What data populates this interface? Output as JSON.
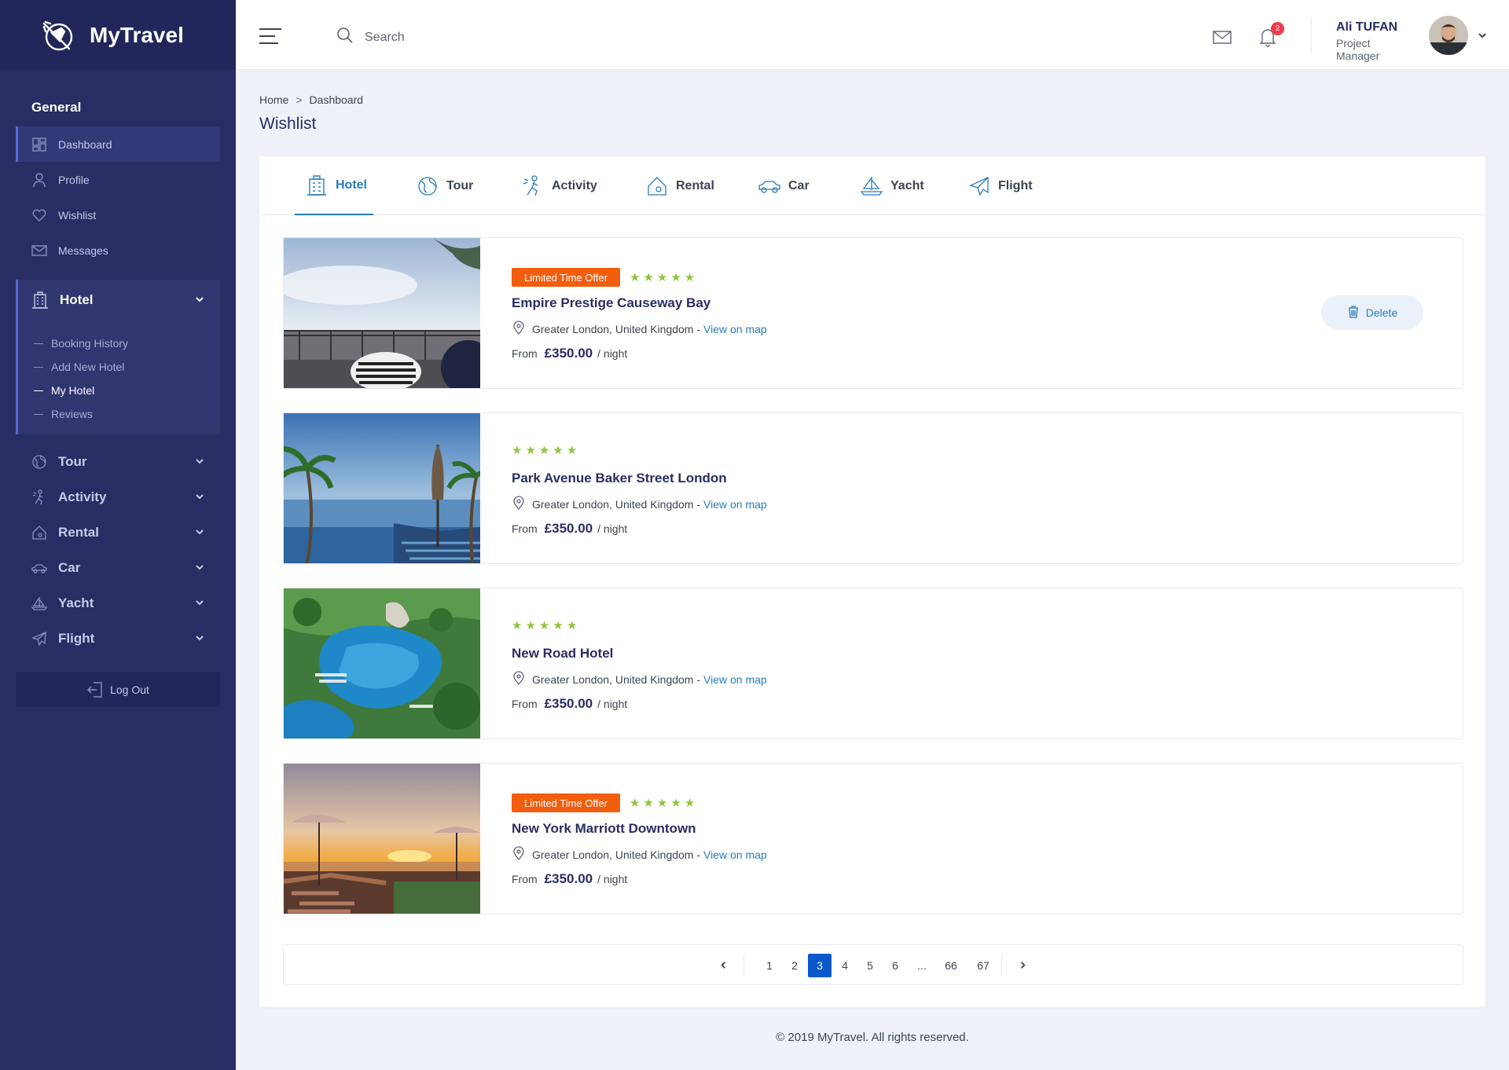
{
  "brand": {
    "name": "MyTravel"
  },
  "sidebar": {
    "section_title": "General",
    "items": [
      {
        "label": "Dashboard",
        "icon": "dashboard-icon"
      },
      {
        "label": "Profile",
        "icon": "user-icon"
      },
      {
        "label": "Wishlist",
        "icon": "heart-icon"
      },
      {
        "label": "Messages",
        "icon": "mail-icon"
      }
    ],
    "hotel_group": {
      "label": "Hotel",
      "subitems": [
        "Booking History",
        "Add New Hotel",
        "My Hotel",
        "Reviews"
      ]
    },
    "categories": [
      "Tour",
      "Activity",
      "Rental",
      "Car",
      "Yacht",
      "Flight"
    ],
    "logout_label": "Log Out"
  },
  "header": {
    "search_placeholder": "Search",
    "notification_count": "2",
    "user_name": "Ali TUFAN",
    "user_role": "Project Manager"
  },
  "breadcrumb": {
    "home": "Home",
    "sep": ">",
    "current": "Dashboard"
  },
  "page_title": "Wishlist",
  "tabs": [
    "Hotel",
    "Tour",
    "Activity",
    "Rental",
    "Car",
    "Yacht",
    "Flight"
  ],
  "active_tab": "Hotel",
  "hotels": [
    {
      "offer": "Limited Time Offer",
      "rating": 5,
      "name": "Empire Prestige Causeway Bay",
      "location": "Greater London, United Kingdom -",
      "map_link": "View on map",
      "from": "From",
      "price": "£350.00",
      "unit": "/ night",
      "delete_label": "Delete"
    },
    {
      "offer": "",
      "rating": 5,
      "name": "Park Avenue Baker Street London",
      "location": "Greater London, United Kingdom -",
      "map_link": "View on map",
      "from": "From",
      "price": "£350.00",
      "unit": "/ night"
    },
    {
      "offer": "",
      "rating": 5,
      "name": "New Road Hotel",
      "location": "Greater London, United Kingdom -",
      "map_link": "View on map",
      "from": "From",
      "price": "£350.00",
      "unit": "/ night"
    },
    {
      "offer": "Limited Time Offer",
      "rating": 5,
      "name": "New York Marriott Downtown",
      "location": "Greater London, United Kingdom -",
      "map_link": "View on map",
      "from": "From",
      "price": "£350.00",
      "unit": "/ night"
    }
  ],
  "pagination": {
    "pages": [
      "1",
      "2",
      "3",
      "4",
      "5",
      "6",
      "...",
      "66",
      "67"
    ],
    "current": "3"
  },
  "footer": "© 2019 MyTravel. All rights reserved.",
  "colors": {
    "sidebar": "#282e63",
    "accent": "#297cbb",
    "offer": "#f25e0e",
    "star": "#8ec63f",
    "page_active": "#0a58ca"
  }
}
